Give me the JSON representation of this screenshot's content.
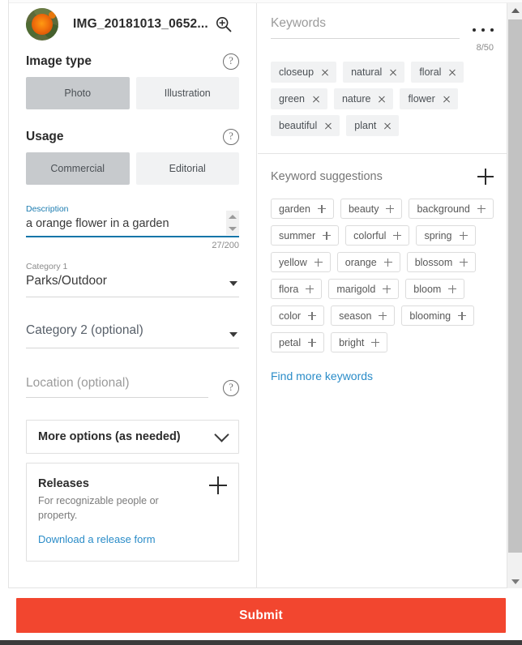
{
  "header": {
    "file_name": "IMG_20181013_0652...",
    "thumbnail_alt": "orange-marigold-flower-thumbnail",
    "zoom_icon": "magnifier-plus-icon"
  },
  "image_type": {
    "title": "Image type",
    "help_icon": "?",
    "options": [
      {
        "label": "Photo",
        "selected": true
      },
      {
        "label": "Illustration",
        "selected": false
      }
    ]
  },
  "usage": {
    "title": "Usage",
    "help_icon": "?",
    "options": [
      {
        "label": "Commercial",
        "selected": true
      },
      {
        "label": "Editorial",
        "selected": false
      }
    ]
  },
  "description": {
    "label": "Description",
    "value": "a orange flower in a garden",
    "counter": "27/200",
    "accent_color": "#1175a8"
  },
  "category1": {
    "label": "Category 1",
    "value": "Parks/Outdoor"
  },
  "category2": {
    "placeholder": "Category 2 (optional)"
  },
  "location": {
    "placeholder": "Location (optional)",
    "help_icon": "?"
  },
  "more_options": {
    "label": "More options (as needed)",
    "chevron_icon": "chevron-down-icon"
  },
  "releases": {
    "title": "Releases",
    "subtitle": "For recognizable people or property.",
    "link": "Download a release form",
    "add_icon": "plus-icon"
  },
  "keywords": {
    "placeholder": "Keywords",
    "menu_icon": "ellipsis-icon",
    "counter": "8/50",
    "chips": [
      "closeup",
      "natural",
      "floral",
      "green",
      "nature",
      "flower",
      "beautiful",
      "plant"
    ]
  },
  "keyword_suggestions": {
    "title": "Keyword suggestions",
    "add_all_icon": "plus-icon",
    "chips": [
      "garden",
      "beauty",
      "background",
      "summer",
      "colorful",
      "spring",
      "yellow",
      "orange",
      "blossom",
      "flora",
      "marigold",
      "bloom",
      "color",
      "season",
      "blooming",
      "petal",
      "bright"
    ],
    "find_more_link": "Find more keywords"
  },
  "submit": {
    "label": "Submit",
    "color": "#f2462f"
  },
  "scrollbar": {
    "up_icon": "scroll-up-arrow",
    "down_icon": "scroll-down-arrow"
  },
  "colors": {
    "accent_blue": "#1175a8",
    "link_blue": "#2a8cc8",
    "selected_toggle": "#c7cacd",
    "unselected_toggle": "#f1f2f3",
    "submit_red": "#f2462f"
  }
}
